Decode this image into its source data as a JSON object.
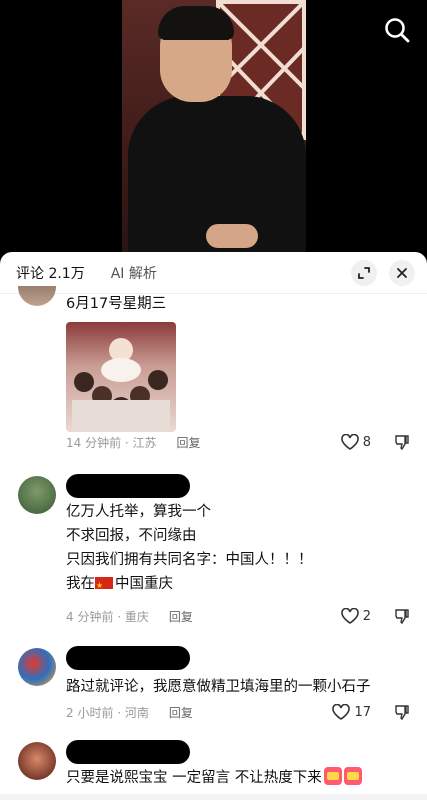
{
  "header": {
    "tab_comments": "评论 2.1万",
    "tab_ai": "AI 解析"
  },
  "comments": [
    {
      "lines": [
        "6月17号星期三"
      ],
      "time": "14 分钟前 · 江苏",
      "reply": "回复",
      "likes": "8",
      "has_image": true
    },
    {
      "lines": [
        "亿万人托举，算我一个",
        "不求回报，不问缘由",
        "只因我们拥有共同名字：中国人！！！",
        "中国重庆"
      ],
      "time": "4 分钟前 · 重庆",
      "reply": "回复",
      "likes": "2"
    },
    {
      "lines": [
        "路过就评论，我愿意做精卫填海里的一颗小石子"
      ],
      "time": "2 小时前 · 河南",
      "reply": "回复",
      "likes": "17"
    },
    {
      "lines": [
        "只要是说熙宝宝 一定留言 不让热度下来"
      ]
    }
  ],
  "prefix_me_at": "我在",
  "colors": {
    "accent": "#111111",
    "meta": "#999999"
  }
}
